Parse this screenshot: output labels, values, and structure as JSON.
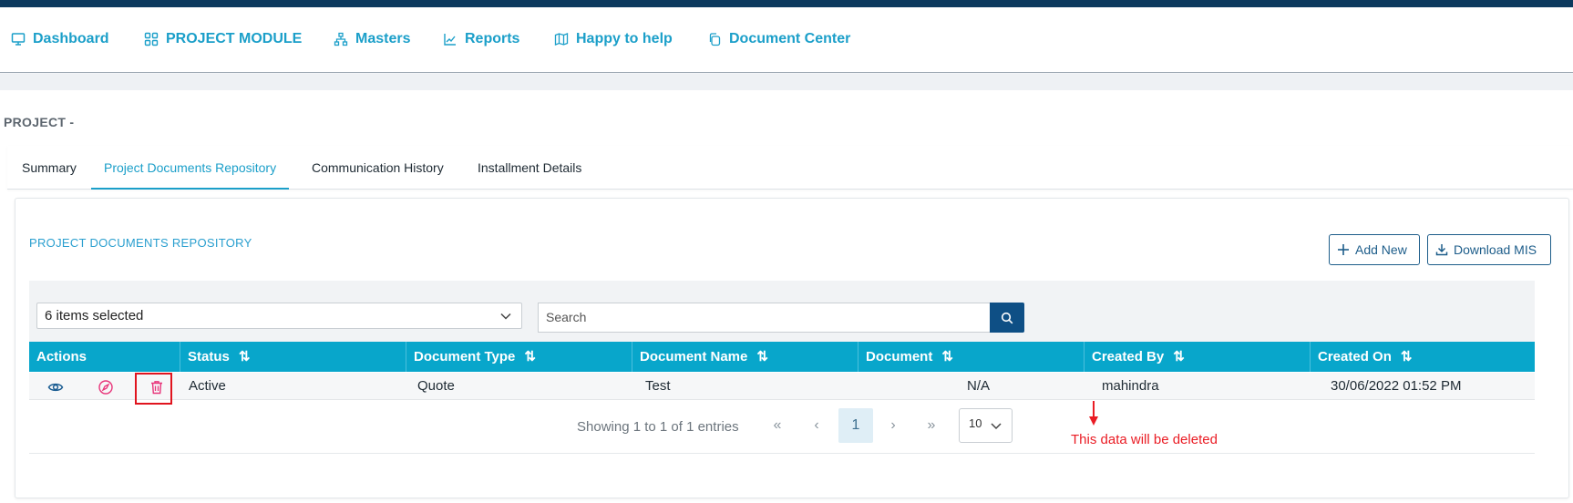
{
  "nav": {
    "items": [
      {
        "label": "Dashboard",
        "icon": "monitor-icon"
      },
      {
        "label": "PROJECT MODULE",
        "icon": "grid-icon"
      },
      {
        "label": "Masters",
        "icon": "sitemap-icon"
      },
      {
        "label": "Reports",
        "icon": "chart-line-icon"
      },
      {
        "label": "Happy to help",
        "icon": "map-icon"
      },
      {
        "label": "Document Center",
        "icon": "copy-icon"
      }
    ],
    "accent": "#1b9fc9",
    "topbar_color": "#0d3a5e"
  },
  "page": {
    "project_label": "PROJECT -"
  },
  "tabs": [
    {
      "label": "Summary",
      "active": false
    },
    {
      "label": "Project Documents Repository",
      "active": true
    },
    {
      "label": "Communication History",
      "active": false
    },
    {
      "label": "Installment Details",
      "active": false
    }
  ],
  "card": {
    "title": "PROJECT DOCUMENTS REPOSITORY",
    "add_new_label": "Add New",
    "download_label": "Download MIS"
  },
  "filters": {
    "select_value": "6 items selected",
    "search_placeholder": "Search"
  },
  "table": {
    "header_color": "#08a6cb",
    "columns": [
      "Actions",
      "Status",
      "Document Type",
      "Document Name",
      "Document",
      "Created By",
      "Created On"
    ],
    "sort_icon": "⇅",
    "rows": [
      {
        "status": "Active",
        "document_type": "Quote",
        "document_name": "Test",
        "document": "N/A",
        "created_by": "mahindra",
        "created_on": "30/06/2022 01:52 PM"
      }
    ]
  },
  "pagination": {
    "showing": "Showing 1 to 1 of 1 entries",
    "first": "«",
    "prev": "‹",
    "current": "1",
    "next": "›",
    "last": "»",
    "page_size": "10"
  },
  "annotation": {
    "text": "This data will be deleted",
    "color": "#ea1c24"
  }
}
